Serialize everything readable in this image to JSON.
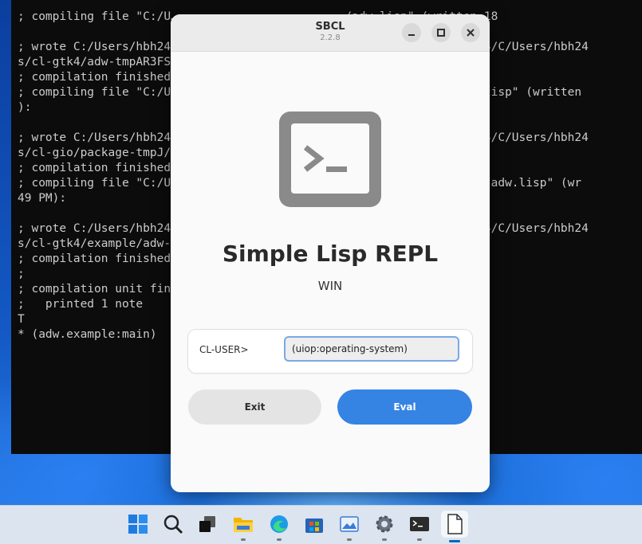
{
  "terminal": {
    "lines": [
      "; compiling file \"C:/U…………………………………………………………………/adw.lisp\" (written 18",
      "",
      "; wrote C:/Users/hbh24                                      -win-x64/C/Users/hbh24",
      "s/cl-gtk4/adw-tmpAR3FS",
      "; compilation finished",
      "; compiling file \"C:/U                                      ackage.lisp\" (written",
      "):",
      "",
      "; wrote C:/Users/hbh24                                      -win-x64/C/Users/hbh24",
      "s/cl-gio/package-tmpJ/",
      "; compilation finished",
      "; compiling file \"C:/U                                      example/adw.lisp\" (wr",
      "49 PM):",
      "",
      "; wrote C:/Users/hbh24                                      -win-x64/C/Users/hbh24",
      "s/cl-gtk4/example/adw-",
      "; compilation finished",
      ";",
      "; compilation unit fin",
      ";   printed 1 note",
      "T",
      "* (adw.example:main)"
    ]
  },
  "dialog": {
    "title": "SBCL",
    "version": "2.2.8",
    "minimize_icon": "minimize-icon",
    "maximize_icon": "maximize-icon",
    "close_icon": "close-icon",
    "heading": "Simple Lisp REPL",
    "subheading": "WIN",
    "prompt_label": "CL-USER>",
    "input_value": "(uiop:operating-system)",
    "exit_label": "Exit",
    "eval_label": "Eval",
    "accent_color": "#3584e4"
  },
  "taskbar": {
    "icons": [
      "windows-start-icon",
      "search-icon",
      "task-view-icon",
      "file-explorer-icon",
      "edge-icon",
      "store-icon",
      "photos-icon",
      "settings-icon",
      "terminal-icon",
      "document-icon"
    ]
  }
}
